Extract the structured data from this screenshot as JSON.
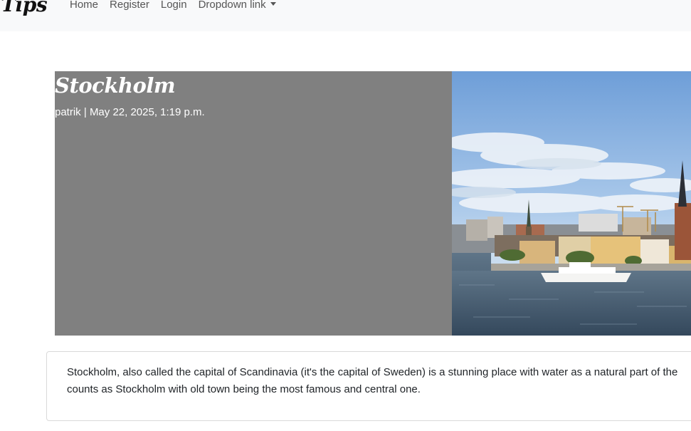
{
  "nav": {
    "brand": "p Tips",
    "links": [
      "Home",
      "Register",
      "Login",
      "Dropdown link"
    ]
  },
  "post": {
    "title": "Stockholm",
    "author": "patrik",
    "separator": "|",
    "date": "May 22, 2025, 1:19 p.m.",
    "image_alt": "Stockholm skyline with Riddarholmen and water",
    "body": "Stockholm, also called the capital of Scandinavia (it's the capital of Sweden) is a stunning place with water as a natural part of the",
    "body_line2": "counts as Stockholm with old town being the most famous and central one."
  },
  "colors": {
    "navbar_bg": "#f8f9fa",
    "hero_bg": "#808080",
    "text": "#212529"
  }
}
